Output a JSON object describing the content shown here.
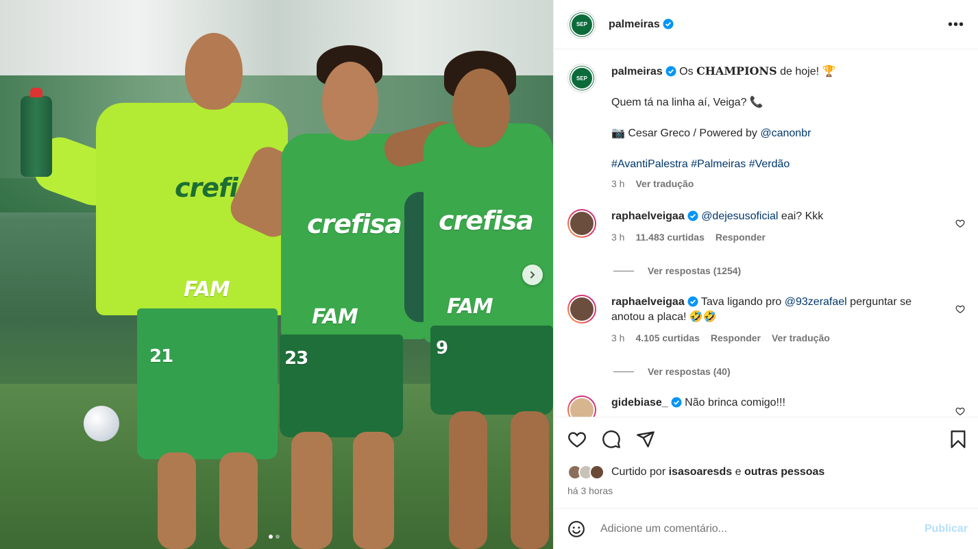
{
  "post": {
    "username": "palmeiras",
    "verified": true
  },
  "caption": {
    "username": "palmeiras",
    "line1_prefix": "Os ",
    "line1_bold": "CHAMPIONS",
    "line1_suffix": " de hoje! 🏆",
    "line2": "Quem tá na linha aí, Veiga? 📞",
    "line3_prefix": "📷 Cesar Greco / Powered by ",
    "line3_mention": "@canonbr",
    "hashtags": "#AvantiPalestra #Palmeiras #Verdão",
    "time": "3 h",
    "translate": "Ver tradução"
  },
  "comments": [
    {
      "username": "raphaelveigaa",
      "mention": "@dejesusoficial",
      "text": " eai? Kkk",
      "time": "3 h",
      "likes": "11.483 curtidas",
      "reply": "Responder",
      "view_replies": "Ver respostas (1254)"
    },
    {
      "username": "raphaelveigaa",
      "text_prefix": "Tava ligando pro ",
      "mention": "@93zerafael",
      "text_suffix": " perguntar se anotou a placa! 🤣🤣",
      "time": "3 h",
      "likes": "4.105 curtidas",
      "reply": "Responder",
      "translate": "Ver tradução",
      "view_replies": "Ver respostas (40)"
    },
    {
      "username": "gidebiase_",
      "text": "Não brinca comigo!!!"
    }
  ],
  "actions": {
    "liked_prefix": "Curtido por ",
    "liked_user": "isasoaresds",
    "liked_and": " e ",
    "liked_others": "outras pessoas",
    "time_ago": "há 3 horas"
  },
  "comment_box": {
    "placeholder": "Adicione um comentário...",
    "publish": "Publicar"
  },
  "media": {
    "shirt_brand": "crefisa",
    "shirt_sponsor": "FAM",
    "numbers": [
      "21",
      "23",
      "9"
    ],
    "slide_count": 2,
    "active_slide": 1
  },
  "colors": {
    "link": "#00376b",
    "publish_disabled": "#b2dffc",
    "club_green": "#0c6b3a",
    "verified": "#0095f6"
  }
}
